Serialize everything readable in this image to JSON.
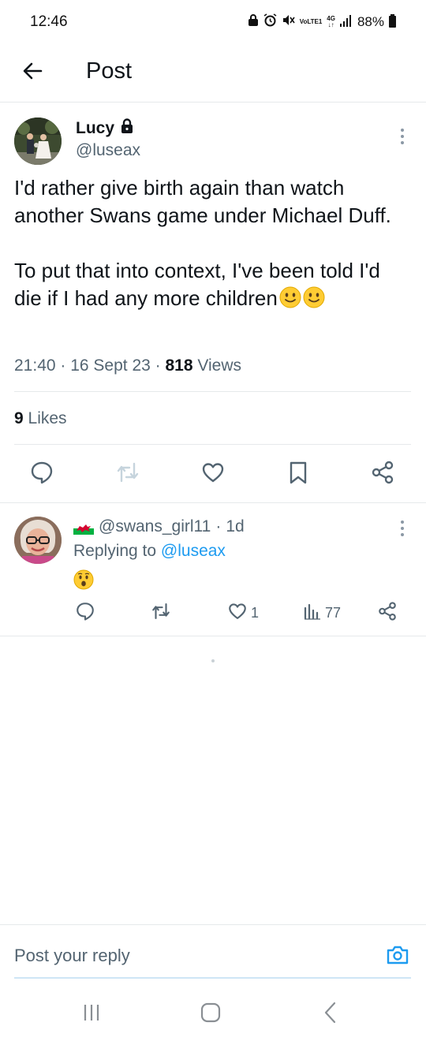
{
  "status_bar": {
    "time": "12:46",
    "network_top": "VoLTE1",
    "network_gen": "4G",
    "battery": "88%",
    "icons": [
      "lock-icon",
      "alarm-icon",
      "mute-icon",
      "lte-icon",
      "signal-icon",
      "battery-icon"
    ]
  },
  "header": {
    "title": "Post",
    "back_icon": "arrow-left-icon"
  },
  "post": {
    "author_name": "Lucy",
    "author_handle": "@luseax",
    "text": "I'd rather give birth again than watch another Swans game under Michael Duff.\n\nTo put that into context, I've been told I'd die if I had any more children",
    "time": "21:40",
    "date": "16 Sept 23",
    "views_count": "818",
    "views_label": "Views",
    "likes_count": "9",
    "likes_label": "Likes",
    "actions": [
      "reply-icon",
      "repost-icon",
      "like-icon",
      "bookmark-icon",
      "share-icon"
    ]
  },
  "reply": {
    "handle": "@swans_girl11",
    "age": "1d",
    "replying_prefix": "Replying to",
    "replying_handle": "@luseax",
    "likes": "1",
    "views": "77"
  },
  "compose": {
    "placeholder": "Post your reply"
  },
  "colors": {
    "accent": "#1d9bf0",
    "text": "#0f1419",
    "secondary": "#536471",
    "divider": "#e6e9eb"
  }
}
